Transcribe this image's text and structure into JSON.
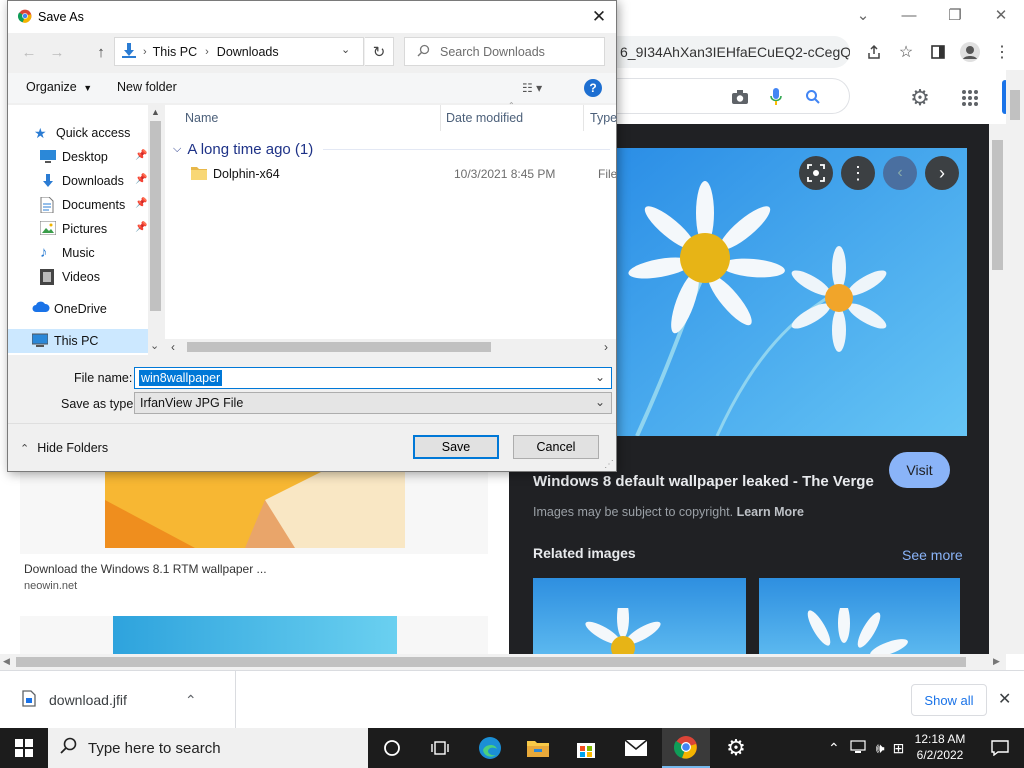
{
  "browser": {
    "url_fragment": "6_9I34AhXan3IEHfaECuEQ2-cCegQ...",
    "panel": {
      "title": "Windows 8 default wallpaper leaked - The Verge",
      "copyright_note": "Images may be subject to copyright.",
      "learn_more": "Learn More",
      "visit_label": "Visit",
      "related_label": "Related images",
      "see_more_label": "See more"
    },
    "result": {
      "title": "Download the Windows 8.1 RTM wallpaper ...",
      "source": "neowin.net"
    },
    "download": {
      "filename": "download.jfif",
      "show_all": "Show all"
    }
  },
  "taskbar": {
    "search_placeholder": "Type here to search",
    "time": "12:18 AM",
    "date": "6/2/2022"
  },
  "dialog": {
    "title": "Save As",
    "breadcrumb": [
      "This PC",
      "Downloads"
    ],
    "search_placeholder": "Search Downloads",
    "organize_label": "Organize",
    "new_folder_label": "New folder",
    "nav_items": [
      {
        "label": "Quick access"
      },
      {
        "label": "Desktop"
      },
      {
        "label": "Downloads"
      },
      {
        "label": "Documents"
      },
      {
        "label": "Pictures"
      },
      {
        "label": "Music"
      },
      {
        "label": "Videos"
      },
      {
        "label": "OneDrive"
      },
      {
        "label": "This PC"
      }
    ],
    "columns": {
      "name": "Name",
      "date": "Date modified",
      "type": "Type"
    },
    "group_label": "A long time ago (1)",
    "files": [
      {
        "name": "Dolphin-x64",
        "date": "10/3/2021 8:45 PM",
        "type": "File fo"
      }
    ],
    "file_name_label": "File name:",
    "file_name_value": "win8wallpaper",
    "save_type_label": "Save as type:",
    "save_type_value": "IrfanView JPG File",
    "hide_folders_label": "Hide Folders",
    "save_label": "Save",
    "cancel_label": "Cancel"
  }
}
